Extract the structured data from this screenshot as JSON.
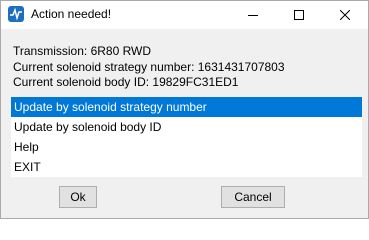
{
  "window": {
    "title": "Action needed!",
    "icon": "waveform-app-icon"
  },
  "titlebar_controls": {
    "minimize": "minimize-icon",
    "maximize": "maximize-icon",
    "close": "close-icon"
  },
  "info": {
    "transmission": "Transmission: 6R80 RWD",
    "strategy_number": "Current solenoid strategy number: 1631431707803",
    "body_id": "Current solenoid body ID: 19829FC31ED1"
  },
  "options": [
    {
      "label": "Update by solenoid strategy number",
      "selected": true
    },
    {
      "label": "Update by solenoid body ID",
      "selected": false
    },
    {
      "label": "Help",
      "selected": false
    },
    {
      "label": "EXIT",
      "selected": false
    }
  ],
  "buttons": {
    "ok": "Ok",
    "cancel": "Cancel"
  },
  "colors": {
    "selection": "#0078d7",
    "titlebar": "#ffffff",
    "dialog_bg": "#f0f0f0"
  }
}
